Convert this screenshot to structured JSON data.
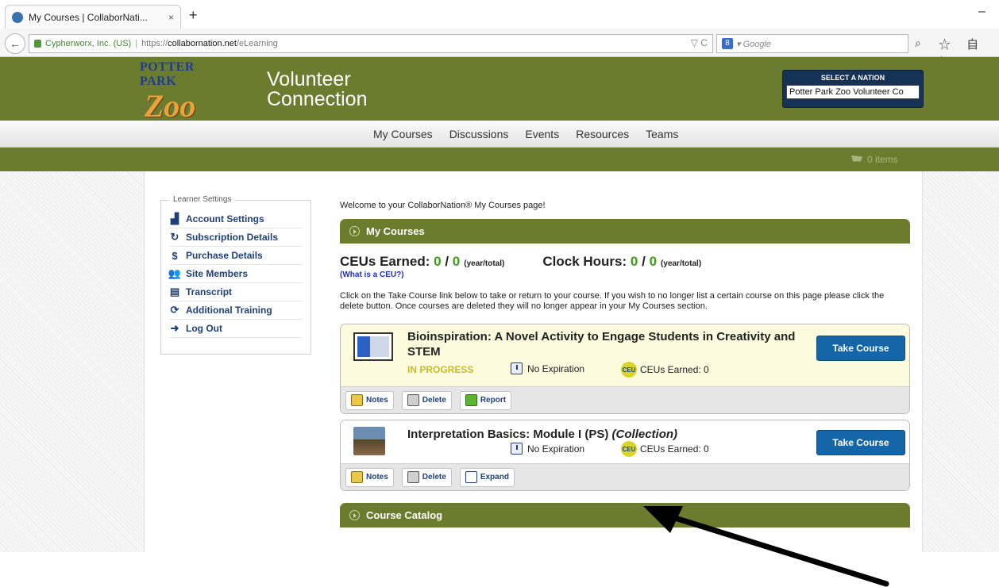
{
  "browser": {
    "tab_title": "My Courses | CollaborNati...",
    "tab_close": "×",
    "new_tab": "+",
    "minimize": "–",
    "back": "←",
    "identity": "Cypherworx, Inc. (US)",
    "url_separator": "|",
    "url_prefix": "https://",
    "url_domain": "collabornation.net",
    "url_path": "/eLearning",
    "url_right_icons": "▽ C",
    "search_engine_badge": "8",
    "search_placeholder": "▾ Google",
    "search_icon": "search-icon",
    "tool_icons": "☆ 自 ↓"
  },
  "header": {
    "logo_top": "POTTER PARK",
    "logo_bottom": "Zoo",
    "title_line1": "Volunteer",
    "title_line2": "Connection",
    "nation_label": "SELECT A NATION",
    "nation_value": "Potter Park Zoo Volunteer Co",
    "brand_color": "#6b7c2f"
  },
  "menu": {
    "items": [
      "My Courses",
      "Discussions",
      "Events",
      "Resources",
      "Teams"
    ]
  },
  "cart": {
    "text": "0 items",
    "icon": "cart-icon"
  },
  "sidebar": {
    "legend": "Learner Settings",
    "items": [
      {
        "label": "Account Settings",
        "icon": "account-icon",
        "glyph": "▟"
      },
      {
        "label": "Subscription Details",
        "icon": "refresh-icon",
        "glyph": "↻"
      },
      {
        "label": "Purchase Details",
        "icon": "dollar-icon",
        "glyph": "$"
      },
      {
        "label": "Site Members",
        "icon": "members-icon",
        "glyph": "👥"
      },
      {
        "label": "Transcript",
        "icon": "document-icon",
        "glyph": "▤"
      },
      {
        "label": "Additional Training",
        "icon": "training-icon",
        "glyph": "⟳"
      },
      {
        "label": "Log Out",
        "icon": "logout-icon",
        "glyph": "➜"
      }
    ]
  },
  "main": {
    "welcome": "Welcome to your CollaborNation® My Courses page!",
    "my_courses_header": "My Courses",
    "ceus_label": "CEUs Earned:",
    "ceus_year": "0",
    "ceus_sep": "/",
    "ceus_total": "0",
    "ceus_suffix": "(year/total)",
    "clock_label": "Clock Hours:",
    "clock_year": "0",
    "clock_sep": "/",
    "clock_total": "0",
    "clock_suffix": "(year/total)",
    "what_is_ceu": "(What is a CEU?)",
    "instructions": "Click on the Take Course link below to take or return to your course. If you wish to no longer list a certain course on this page please click the delete button. Once courses are deleted they will no longer appear in your My Courses section.",
    "catalog_header": "Course Catalog"
  },
  "courses": [
    {
      "title": "Bioinspiration: A Novel Activity to Engage Students in Creativity and STEM",
      "status": "IN PROGRESS",
      "expiration": "No Expiration",
      "ceu_badge": "CEU",
      "ceus": "CEUs Earned: 0",
      "take": "Take Course",
      "actions": [
        "Notes",
        "Delete",
        "Report"
      ]
    },
    {
      "title": "Interpretation Basics: Module I (PS)",
      "title_suffix": "(Collection)",
      "expiration": "No Expiration",
      "ceu_badge": "CEU",
      "ceus": "CEUs Earned: 0",
      "take": "Take Course",
      "actions": [
        "Notes",
        "Delete",
        "Expand"
      ]
    }
  ]
}
